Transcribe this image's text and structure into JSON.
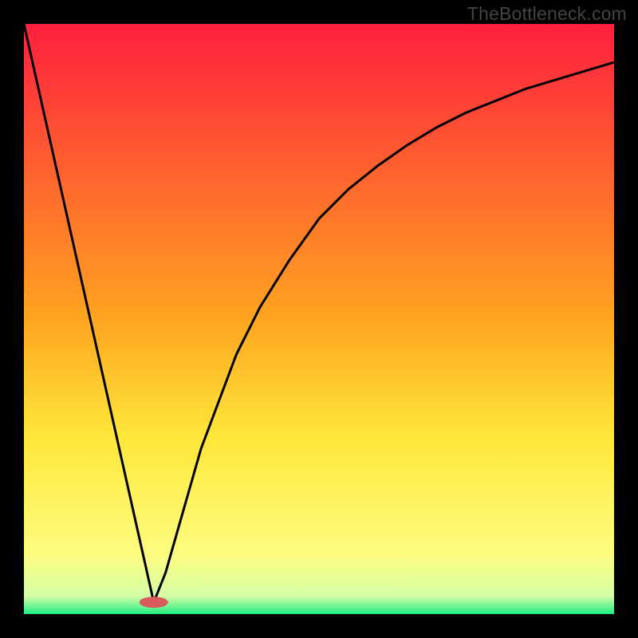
{
  "watermark": "TheBottleneck.com",
  "chart_data": {
    "type": "line",
    "title": "",
    "xlabel": "",
    "ylabel": "",
    "xlim": [
      0,
      100
    ],
    "ylim": [
      0,
      100
    ],
    "background_gradient": {
      "stops": [
        {
          "pct": 0,
          "color": "#ff1f3e"
        },
        {
          "pct": 50,
          "color": "#ffa520"
        },
        {
          "pct": 70,
          "color": "#ffe73a"
        },
        {
          "pct": 90,
          "color": "#fdfd80"
        },
        {
          "pct": 97,
          "color": "#d4ffa7"
        },
        {
          "pct": 100,
          "color": "#20ed82"
        }
      ]
    },
    "touchdown": {
      "x": 22,
      "y": 2,
      "color": "#d85a5a"
    },
    "series": [
      {
        "name": "left-branch",
        "x": [
          0,
          22
        ],
        "values": [
          100,
          2
        ]
      },
      {
        "name": "right-branch",
        "x": [
          22,
          24,
          26,
          28,
          30,
          33,
          36,
          40,
          45,
          50,
          55,
          60,
          65,
          70,
          75,
          80,
          85,
          90,
          95,
          100
        ],
        "values": [
          2,
          7,
          14,
          21,
          28,
          36,
          44,
          52,
          60,
          67,
          72,
          76,
          79.5,
          82.5,
          85,
          87,
          89,
          90.5,
          92,
          93.5
        ]
      }
    ],
    "annotations": []
  }
}
